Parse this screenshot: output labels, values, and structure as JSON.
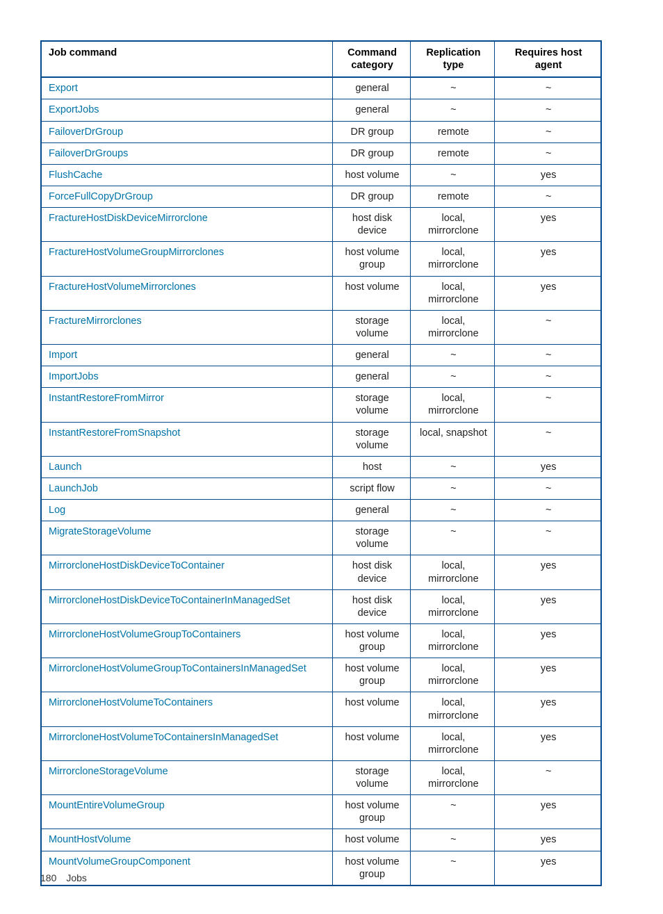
{
  "table": {
    "headers": {
      "job_command": "Job command",
      "command_category": "Command category",
      "replication_type": "Replication type",
      "requires_host_agent": "Requires host agent"
    },
    "rows": [
      {
        "cmd": "Export",
        "cat": "general",
        "rep": "~",
        "host": "~"
      },
      {
        "cmd": "ExportJobs",
        "cat": "general",
        "rep": "~",
        "host": "~"
      },
      {
        "cmd": "FailoverDrGroup",
        "cat": "DR group",
        "rep": "remote",
        "host": "~"
      },
      {
        "cmd": "FailoverDrGroups",
        "cat": "DR group",
        "rep": "remote",
        "host": "~"
      },
      {
        "cmd": "FlushCache",
        "cat": "host volume",
        "rep": "~",
        "host": "yes"
      },
      {
        "cmd": "ForceFullCopyDrGroup",
        "cat": "DR group",
        "rep": "remote",
        "host": "~"
      },
      {
        "cmd": "FractureHostDiskDeviceMirrorclone",
        "cat": "host disk device",
        "rep": "local, mirrorclone",
        "host": "yes"
      },
      {
        "cmd": "FractureHostVolumeGroupMirrorclones",
        "cat": "host volume group",
        "rep": "local, mirrorclone",
        "host": "yes"
      },
      {
        "cmd": "FractureHostVolumeMirrorclones",
        "cat": "host volume",
        "rep": "local, mirrorclone",
        "host": "yes"
      },
      {
        "cmd": "FractureMirrorclones",
        "cat": "storage volume",
        "rep": "local, mirrorclone",
        "host": "~"
      },
      {
        "cmd": "Import",
        "cat": "general",
        "rep": "~",
        "host": "~"
      },
      {
        "cmd": "ImportJobs",
        "cat": "general",
        "rep": "~",
        "host": "~"
      },
      {
        "cmd": "InstantRestoreFromMirror",
        "cat": "storage volume",
        "rep": "local, mirrorclone",
        "host": "~"
      },
      {
        "cmd": "InstantRestoreFromSnapshot",
        "cat": "storage volume",
        "rep": "local, snapshot",
        "host": "~"
      },
      {
        "cmd": "Launch",
        "cat": "host",
        "rep": "~",
        "host": "yes"
      },
      {
        "cmd": "LaunchJob",
        "cat": "script flow",
        "rep": "~",
        "host": "~"
      },
      {
        "cmd": "Log",
        "cat": "general",
        "rep": "~",
        "host": "~"
      },
      {
        "cmd": "MigrateStorageVolume",
        "cat": "storage volume",
        "rep": "~",
        "host": "~"
      },
      {
        "cmd": "MirrorcloneHostDiskDeviceToContainer",
        "cat": "host disk device",
        "rep": "local, mirrorclone",
        "host": "yes"
      },
      {
        "cmd": "MirrorcloneHostDiskDeviceToContainerInManagedSet",
        "cat": "host disk device",
        "rep": "local, mirrorclone",
        "host": "yes"
      },
      {
        "cmd": "MirrorcloneHostVolumeGroupToContainers",
        "cat": "host volume group",
        "rep": "local, mirrorclone",
        "host": "yes"
      },
      {
        "cmd": "MirrorcloneHostVolumeGroupToContainersInManagedSet",
        "cat": "host volume group",
        "rep": "local, mirrorclone",
        "host": "yes"
      },
      {
        "cmd": "MirrorcloneHostVolumeToContainers",
        "cat": "host volume",
        "rep": "local, mirrorclone",
        "host": "yes"
      },
      {
        "cmd": "MirrorcloneHostVolumeToContainersInManagedSet",
        "cat": "host volume",
        "rep": "local, mirrorclone",
        "host": "yes"
      },
      {
        "cmd": "MirrorcloneStorageVolume",
        "cat": "storage volume",
        "rep": "local, mirrorclone",
        "host": "~"
      },
      {
        "cmd": "MountEntireVolumeGroup",
        "cat": "host volume group",
        "rep": "~",
        "host": "yes"
      },
      {
        "cmd": "MountHostVolume",
        "cat": "host volume",
        "rep": "~",
        "host": "yes"
      },
      {
        "cmd": "MountVolumeGroupComponent",
        "cat": "host volume group",
        "rep": "~",
        "host": "yes"
      }
    ]
  },
  "footer": {
    "page_number": "180",
    "section": "Jobs"
  }
}
